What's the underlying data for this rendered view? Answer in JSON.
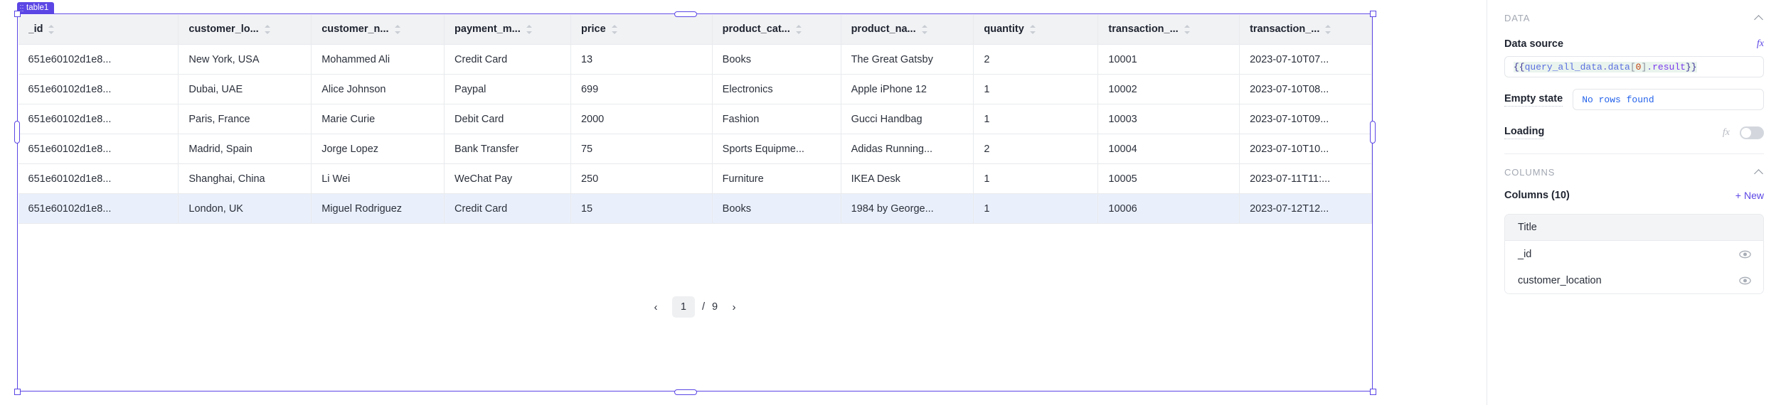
{
  "widget": {
    "name": "table1",
    "drag_handle_icon": "drag-dots-icon"
  },
  "table": {
    "columns": [
      {
        "label": "_id",
        "sort_icon": "sort-arrows-icon"
      },
      {
        "label": "customer_lo...",
        "sort_icon": "sort-arrows-icon"
      },
      {
        "label": "customer_n...",
        "sort_icon": "sort-arrows-icon"
      },
      {
        "label": "payment_m...",
        "sort_icon": "sort-arrows-icon"
      },
      {
        "label": "price",
        "sort_icon": "sort-arrows-icon"
      },
      {
        "label": "product_cat...",
        "sort_icon": "sort-arrows-icon"
      },
      {
        "label": "product_na...",
        "sort_icon": "sort-arrows-icon"
      },
      {
        "label": "quantity",
        "sort_icon": "sort-arrows-icon"
      },
      {
        "label": "transaction_...",
        "sort_icon": "sort-arrows-icon"
      },
      {
        "label": "transaction_...",
        "sort_icon": "sort-arrows-icon"
      }
    ],
    "rows": [
      {
        "selected": false,
        "cells": [
          "651e60102d1e8...",
          "New York, USA",
          "Mohammed Ali",
          "Credit Card",
          "13",
          "Books",
          "The Great Gatsby",
          "2",
          "10001",
          "2023-07-10T07..."
        ]
      },
      {
        "selected": false,
        "cells": [
          "651e60102d1e8...",
          "Dubai, UAE",
          "Alice Johnson",
          "Paypal",
          "699",
          "Electronics",
          "Apple iPhone 12",
          "1",
          "10002",
          "2023-07-10T08..."
        ]
      },
      {
        "selected": false,
        "cells": [
          "651e60102d1e8...",
          "Paris, France",
          "Marie Curie",
          "Debit Card",
          "2000",
          "Fashion",
          "Gucci Handbag",
          "1",
          "10003",
          "2023-07-10T09..."
        ]
      },
      {
        "selected": false,
        "cells": [
          "651e60102d1e8...",
          "Madrid, Spain",
          "Jorge Lopez",
          "Bank Transfer",
          "75",
          "Sports Equipme...",
          "Adidas Running...",
          "2",
          "10004",
          "2023-07-10T10..."
        ]
      },
      {
        "selected": false,
        "cells": [
          "651e60102d1e8...",
          "Shanghai, China",
          "Li Wei",
          "WeChat Pay",
          "250",
          "Furniture",
          "IKEA Desk",
          "1",
          "10005",
          "2023-07-11T11:..."
        ]
      },
      {
        "selected": true,
        "cells": [
          "651e60102d1e8...",
          "London, UK",
          "Miguel Rodriguez",
          "Credit Card",
          "15",
          "Books",
          "1984 by George...",
          "1",
          "10006",
          "2023-07-12T12..."
        ]
      }
    ],
    "pagination": {
      "prev_label": "‹",
      "current_page": "1",
      "separator": "/",
      "total_pages": "9",
      "next_label": "›"
    }
  },
  "sidebar": {
    "data_section": {
      "title": "DATA",
      "collapse_icon": "chevron-up-icon",
      "data_source": {
        "label": "Data source",
        "fx_label": "fx",
        "value": "{{query_all_data.data[0].result}}",
        "tokens": {
          "open": "{{",
          "name": "query_all_data",
          "dot1": ".",
          "prop1": "data",
          "bracket_open": "[",
          "index": "0",
          "bracket_close": "]",
          "dot2": ".",
          "prop2": "result",
          "close": "}}"
        }
      },
      "empty_state": {
        "label": "Empty state",
        "value": "No rows found"
      },
      "loading": {
        "label": "Loading",
        "fx_label": "fx",
        "enabled": false
      }
    },
    "columns_section": {
      "title": "COLUMNS",
      "collapse_icon": "chevron-up-icon",
      "count_label": "Columns (10)",
      "new_button": "+ New",
      "new_plus": "+",
      "new_text": "New",
      "table_header": "Title",
      "items": [
        {
          "title": "_id",
          "visibility_icon": "eye-icon"
        },
        {
          "title": "customer_location",
          "visibility_icon": "eye-icon"
        }
      ]
    }
  },
  "colors": {
    "accent": "#5b46e5",
    "selected_row": "#eaf0fb",
    "header_bg": "#f1f2f4",
    "border": "#e8eaed",
    "code_string": "#2563eb"
  }
}
